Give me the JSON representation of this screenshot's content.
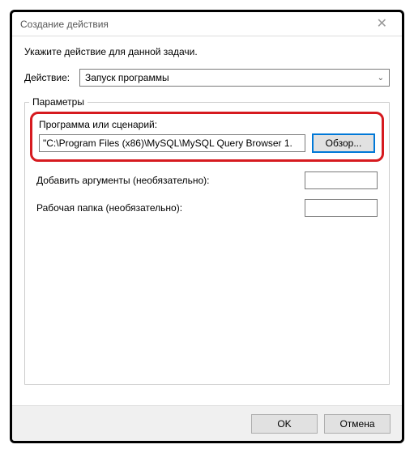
{
  "window": {
    "title": "Создание действия"
  },
  "instruction": "Укажите действие для данной задачи.",
  "action": {
    "label": "Действие:",
    "selected": "Запуск программы"
  },
  "params": {
    "group_label": "Параметры",
    "program_label": "Программа или сценарий:",
    "program_value": "\"C:\\Program Files (x86)\\MySQL\\MySQL Query Browser 1.",
    "browse_label": "Обзор...",
    "args_label": "Добавить аргументы (необязательно):",
    "start_in_label": "Рабочая папка (необязательно):"
  },
  "buttons": {
    "ok": "OK",
    "cancel": "Отмена"
  }
}
